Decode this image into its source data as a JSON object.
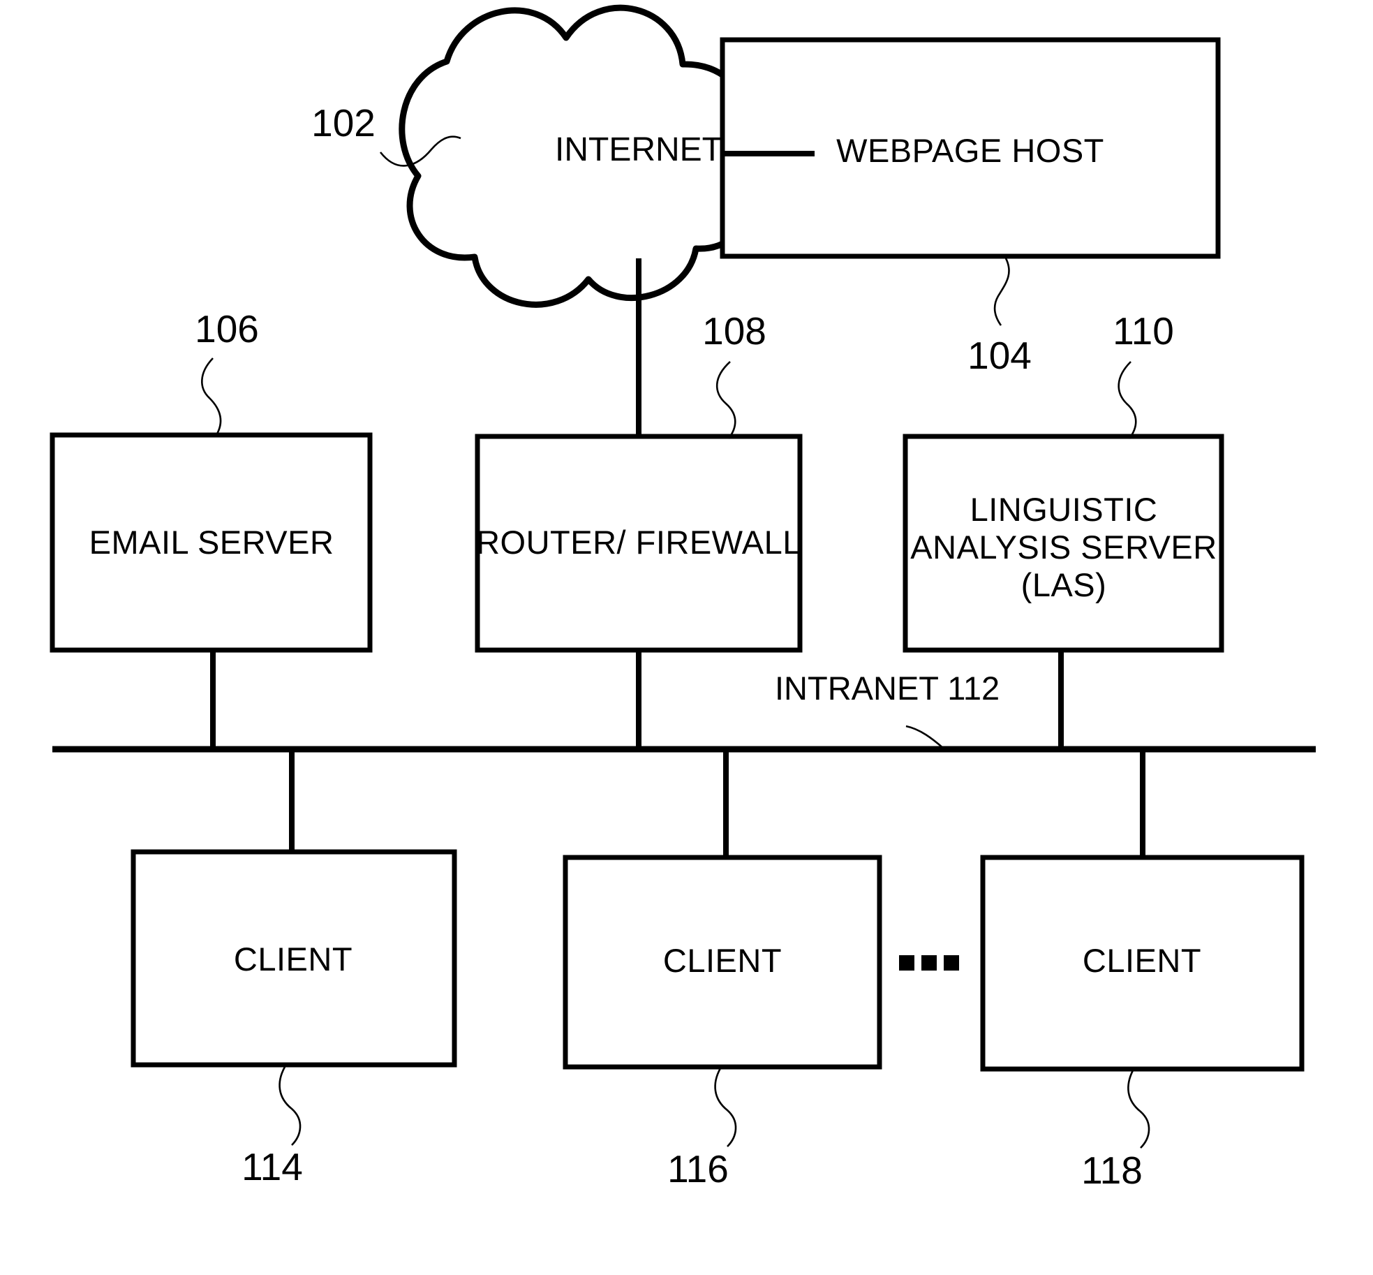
{
  "figure": {
    "type": "patent-network-diagram",
    "background_color": "#ffffff",
    "line_color": "#000000"
  },
  "cloud": {
    "label": "INTERNET",
    "ref": "102"
  },
  "nodes": {
    "webpage_host": {
      "label": "WEBPAGE HOST",
      "ref": "104"
    },
    "email_server": {
      "label": "EMAIL SERVER",
      "ref": "106"
    },
    "router_firewall": {
      "label": "ROUTER/ FIREWALL",
      "ref": "108"
    },
    "linguistic_analysis_server": {
      "label_line1": "LINGUISTIC",
      "label_line2": "ANALYSIS SERVER",
      "label_line3": "(LAS)",
      "ref": "110"
    }
  },
  "network": {
    "intranet_label": "INTRANET 112"
  },
  "clients": [
    {
      "label": "CLIENT",
      "ref": "114"
    },
    {
      "label": "CLIENT",
      "ref": "116"
    },
    {
      "label": "CLIENT",
      "ref": "118"
    }
  ],
  "ellipsis": {
    "glyph": "▪ ▪ ▪",
    "meaning": "additional-clients"
  }
}
